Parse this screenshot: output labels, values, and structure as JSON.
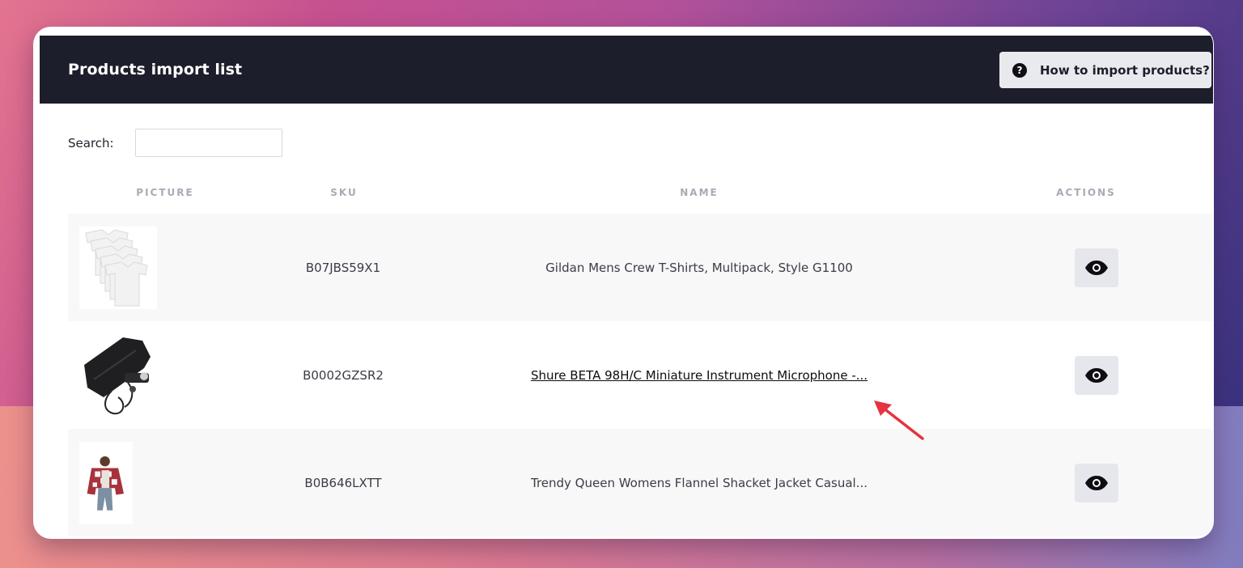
{
  "header": {
    "title": "Products import list",
    "help_button": "How to import products?",
    "help_icon": "?"
  },
  "search": {
    "label": "Search:",
    "value": "",
    "placeholder": ""
  },
  "table": {
    "columns": [
      "PICTURE",
      "SKU",
      "NAME",
      "ACTIONS"
    ],
    "rows": [
      {
        "picture": "white-tshirts-multipack",
        "sku": "B07JBS59X1",
        "name": "Gildan Mens Crew T-Shirts, Multipack, Style G1100",
        "action": "eye-icon"
      },
      {
        "picture": "microphone-kit",
        "sku": "B0002GZSR2",
        "name": "Shure BETA 98H/C Miniature Instrument Microphone -...",
        "action": "eye-icon"
      },
      {
        "picture": "flannel-shacket-jacket",
        "sku": "B0B646LXTT",
        "name": "Trendy Queen Womens Flannel Shacket Jacket Casual...",
        "action": "eye-icon"
      }
    ]
  },
  "colors": {
    "header_bg": "#1d1e2b",
    "row_alt_bg": "#f8f8f9",
    "button_bg": "#e6e7ec",
    "annotation_arrow": "#e5333f"
  }
}
